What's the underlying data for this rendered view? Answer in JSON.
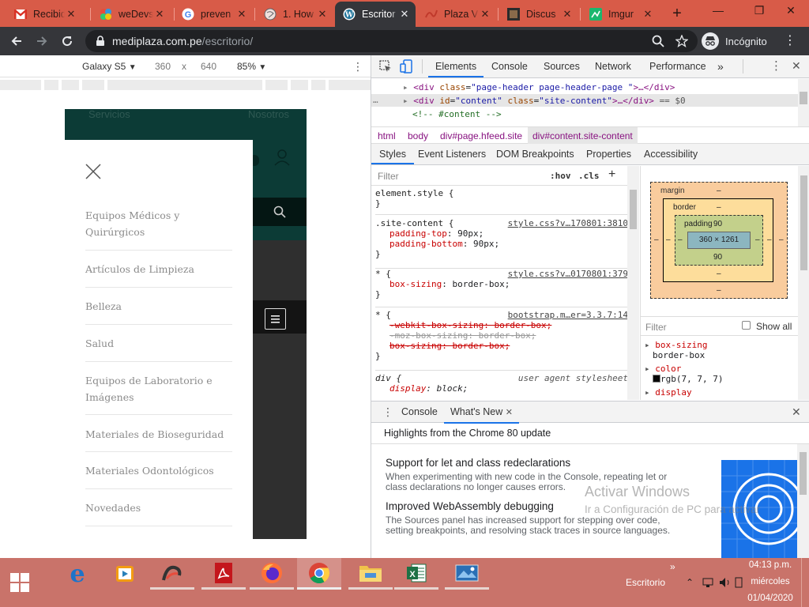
{
  "browser": {
    "tabs": [
      {
        "title": "Recibid",
        "icon": "gmail-icon"
      },
      {
        "title": "weDevs",
        "icon": "wedevs-icon"
      },
      {
        "title": "preven",
        "icon": "google-icon"
      },
      {
        "title": "1. How",
        "icon": "globe-icon"
      },
      {
        "title": "Escritor",
        "icon": "wordpress-icon",
        "active": true
      },
      {
        "title": "Plaza V",
        "icon": "plaza-icon"
      },
      {
        "title": "Discus",
        "icon": "discuss-icon"
      },
      {
        "title": "Imgur",
        "icon": "imgur-icon"
      }
    ],
    "new_tab": "+",
    "window": {
      "minimize": "—",
      "restore": "❐",
      "close": "✕"
    },
    "url_host": "mediplaza.com.pe",
    "url_path": "/escritorio/",
    "incognito_label": "Incógnito"
  },
  "device_toolbar": {
    "device": "Galaxy S5",
    "width": "360",
    "times": "x",
    "height": "640",
    "zoom": "85%"
  },
  "mobile_page": {
    "top_links": [
      "Servicios",
      "Nosotros"
    ],
    "menu_items": [
      "Equipos Médicos y Quirúrgicos",
      "Artículos de Limpieza",
      "Belleza",
      "Salud",
      "Equipos de Laboratorio e Imágenes",
      "Materiales de Bioseguridad",
      "Materiales Odontológicos",
      "Novedades"
    ]
  },
  "devtools": {
    "tabs": [
      "Elements",
      "Console",
      "Sources",
      "Network",
      "Performance"
    ],
    "more": "»",
    "elements_lines": {
      "line1": {
        "tag_open": "<div",
        "attr": "class",
        "value": "\"page-header page-header-page \"",
        "rest": ">…</div>"
      },
      "line2": {
        "tag_open": "<div",
        "attr1": "id",
        "value1": "\"content\"",
        "attr2": "class",
        "value2": "\"site-content\"",
        "rest": ">…</div>",
        "eq": "== $0"
      },
      "line3": "<!-- #content -->"
    },
    "breadcrumbs": [
      "html",
      "body",
      "div#page.hfeed.site",
      "div#content.site-content"
    ],
    "sub_tabs": [
      "Styles",
      "Event Listeners",
      "DOM Breakpoints",
      "Properties",
      "Accessibility"
    ],
    "filter_placeholder": "Filter",
    "hov": ":hov",
    "cls": ".cls",
    "rules": {
      "element_style": "element.style {",
      "site_content_sel": ".site-content {",
      "site_content_src": "style.css?v…170801:3810",
      "padding_top": {
        "prop": "padding-top",
        "val": "90px;"
      },
      "padding_bottom": {
        "prop": "padding-bottom",
        "val": "90px;"
      },
      "star_sel": "* {",
      "star_src": "style.css?v…0170801:379",
      "box_sizing": {
        "prop": "box-sizing",
        "val": "border-box;"
      },
      "bootstrap_src": "bootstrap.m…er=3.3.7:14",
      "webkit": "-webkit-box-sizing: border-box;",
      "moz": "-moz-box-sizing: border-box;",
      "box": "box-sizing: border-box;",
      "div_sel": "div {",
      "ua": "user agent stylesheet",
      "display": {
        "prop": "display",
        "val": "block;"
      },
      "close_brace": "}"
    },
    "box_model": {
      "margin_label": "margin",
      "border_label": "border",
      "padding_label": "padding",
      "dash": "–",
      "padding_top": "90",
      "padding_bottom": "90",
      "content": "360 × 1261"
    },
    "computed": {
      "filter_placeholder": "Filter",
      "show_all": "Show all",
      "items": [
        {
          "name": "box-sizing",
          "value": "border-box"
        },
        {
          "name": "color",
          "value": "rgb(7, 7, 7)",
          "swatch": "#070707"
        },
        {
          "name": "display",
          "value": ""
        }
      ]
    },
    "drawer": {
      "tabs": [
        "Console",
        "What's New"
      ],
      "highlights": "Highlights from the Chrome 80 update",
      "items": [
        {
          "title": "Support for let and class redeclarations",
          "text": "When experimenting with new code in the Console, repeating let or class declarations no longer causes errors."
        },
        {
          "title": "Improved WebAssembly debugging",
          "text": "The Sources panel has increased support for stepping over code, setting breakpoints, and resolving stack traces in source languages."
        }
      ]
    }
  },
  "watermark": {
    "line1": "Activar Windows",
    "line2": "Ir a Configuración de PC para activar"
  },
  "taskbar": {
    "apps": [
      "start",
      "edge",
      "media-player",
      "scrcpy",
      "acrobat",
      "firefox",
      "chrome",
      "file-explorer",
      "excel",
      "photos"
    ],
    "desktop_label": "Escritorio",
    "overflow": "»",
    "time": "04:13 p.m.",
    "day": "miércoles",
    "date": "01/04/2020"
  },
  "colors": {
    "tabstrip": "#d85b48",
    "toolbar": "#35363a",
    "taskbar": "#c9736a",
    "devtools_accent": "#1a73e8",
    "page_teal": "#0c3b36"
  }
}
